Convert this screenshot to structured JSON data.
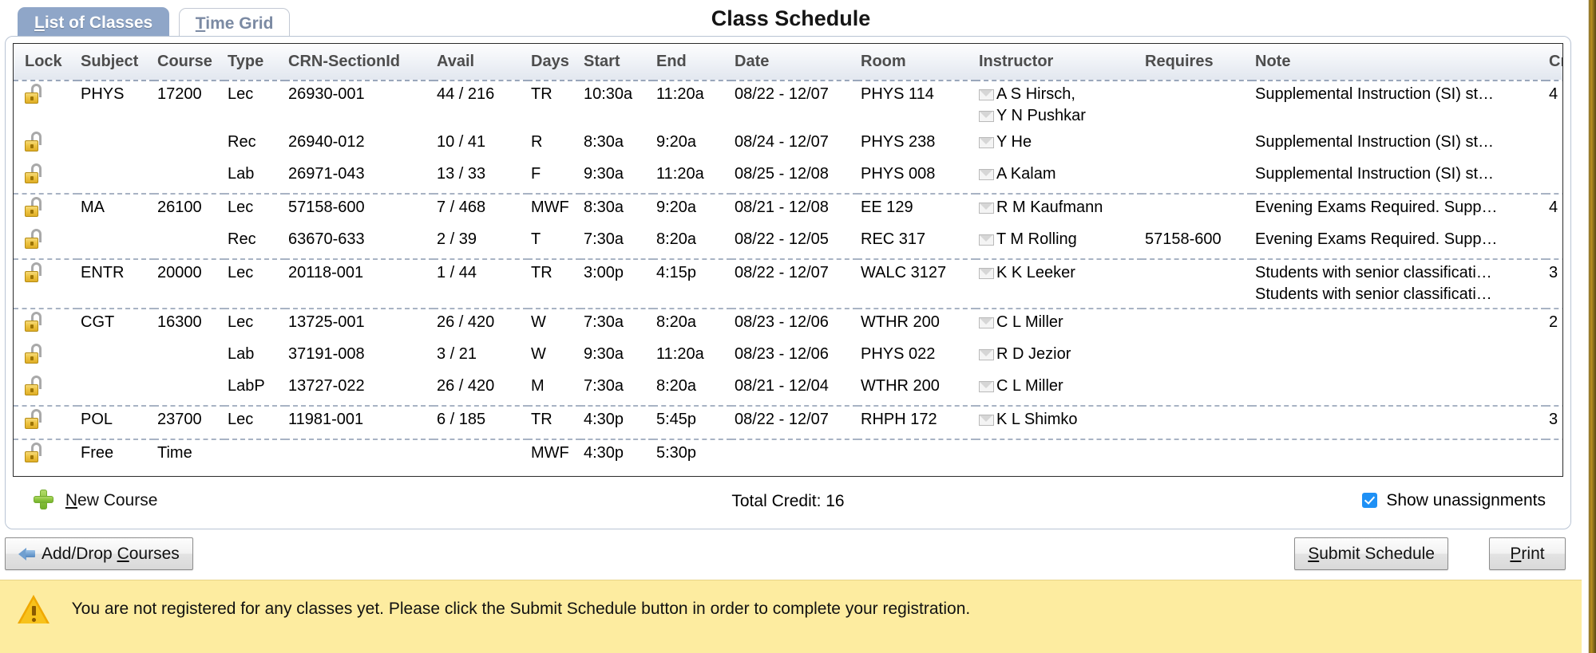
{
  "header": {
    "title": "Class Schedule",
    "tabs": [
      {
        "label": "List of Classes",
        "active": true
      },
      {
        "label": "Time Grid",
        "active": false
      }
    ]
  },
  "table": {
    "columns": [
      "Lock",
      "Subject",
      "Course",
      "Type",
      "CRN-SectionId",
      "Avail",
      "Days",
      "Start",
      "End",
      "Date",
      "Room",
      "Instructor",
      "Requires",
      "Note",
      "Credit"
    ],
    "rows": [
      {
        "group_start": true,
        "subject": "PHYS",
        "course": "17200",
        "type": "Lec",
        "crn": "26930-001",
        "avail": "44 / 216",
        "days": "TR",
        "start": "10:30a",
        "end": "11:20a",
        "date": "08/22 - 12/07",
        "room": "PHYS 114",
        "instructors": [
          "A S Hirsch,",
          "Y N Pushkar"
        ],
        "requires": "",
        "notes": [
          "Supplemental Instruction (SI) st…"
        ],
        "credit": "4"
      },
      {
        "group_start": false,
        "subject": "",
        "course": "",
        "type": "Rec",
        "crn": "26940-012",
        "avail": "10 / 41",
        "days": "R",
        "start": "8:30a",
        "end": "9:20a",
        "date": "08/24 - 12/07",
        "room": "PHYS 238",
        "instructors": [
          "Y He"
        ],
        "requires": "",
        "notes": [
          "Supplemental Instruction (SI) st…"
        ],
        "credit": ""
      },
      {
        "group_start": false,
        "subject": "",
        "course": "",
        "type": "Lab",
        "crn": "26971-043",
        "avail": "13 / 33",
        "days": "F",
        "start": "9:30a",
        "end": "11:20a",
        "date": "08/25 - 12/08",
        "room": "PHYS 008",
        "instructors": [
          "A Kalam"
        ],
        "requires": "",
        "notes": [
          "Supplemental Instruction (SI) st…"
        ],
        "credit": ""
      },
      {
        "group_start": true,
        "subject": "MA",
        "course": "26100",
        "type": "Lec",
        "crn": "57158-600",
        "avail": "7 / 468",
        "days": "MWF",
        "start": "8:30a",
        "end": "9:20a",
        "date": "08/21 - 12/08",
        "room": "EE 129",
        "instructors": [
          "R M Kaufmann"
        ],
        "requires": "",
        "notes": [
          "Evening Exams Required. Supp…"
        ],
        "credit": "4"
      },
      {
        "group_start": false,
        "subject": "",
        "course": "",
        "type": "Rec",
        "crn": "63670-633",
        "avail": "2 / 39",
        "days": "T",
        "start": "7:30a",
        "end": "8:20a",
        "date": "08/22 - 12/05",
        "room": "REC 317",
        "instructors": [
          "T M Rolling"
        ],
        "requires": "57158-600",
        "notes": [
          "Evening Exams Required. Supp…"
        ],
        "credit": ""
      },
      {
        "group_start": true,
        "subject": "ENTR",
        "course": "20000",
        "type": "Lec",
        "crn": "20118-001",
        "avail": "1 / 44",
        "days": "TR",
        "start": "3:00p",
        "end": "4:15p",
        "date": "08/22 - 12/07",
        "room": "WALC 3127",
        "instructors": [
          "K K Leeker"
        ],
        "requires": "",
        "notes": [
          "Students with senior classificati…",
          "Students with senior classificati…"
        ],
        "credit": "3"
      },
      {
        "group_start": true,
        "subject": "CGT",
        "course": "16300",
        "type": "Lec",
        "crn": "13725-001",
        "avail": "26 / 420",
        "days": "W",
        "start": "7:30a",
        "end": "8:20a",
        "date": "08/23 - 12/06",
        "room": "WTHR 200",
        "instructors": [
          "C L Miller"
        ],
        "requires": "",
        "notes": [],
        "credit": "2"
      },
      {
        "group_start": false,
        "subject": "",
        "course": "",
        "type": "Lab",
        "crn": "37191-008",
        "avail": "3 / 21",
        "days": "W",
        "start": "9:30a",
        "end": "11:20a",
        "date": "08/23 - 12/06",
        "room": "PHYS 022",
        "instructors": [
          "R D Jezior"
        ],
        "requires": "",
        "notes": [],
        "credit": ""
      },
      {
        "group_start": false,
        "subject": "",
        "course": "",
        "type": "LabP",
        "crn": "13727-022",
        "avail": "26 / 420",
        "days": "M",
        "start": "7:30a",
        "end": "8:20a",
        "date": "08/21 - 12/04",
        "room": "WTHR 200",
        "instructors": [
          "C L Miller"
        ],
        "requires": "",
        "notes": [],
        "credit": ""
      },
      {
        "group_start": true,
        "subject": "POL",
        "course": "23700",
        "type": "Lec",
        "crn": "11981-001",
        "avail": "6 / 185",
        "days": "TR",
        "start": "4:30p",
        "end": "5:45p",
        "date": "08/22 - 12/07",
        "room": "RHPH 172",
        "instructors": [
          "K L Shimko"
        ],
        "requires": "",
        "notes": [],
        "credit": "3"
      },
      {
        "group_start": true,
        "subject": "Free",
        "course": "Time",
        "type": "",
        "crn": "",
        "avail": "",
        "days": "MWF",
        "start": "4:30p",
        "end": "5:30p",
        "date": "",
        "room": "",
        "instructors": [],
        "requires": "",
        "notes": [],
        "credit": "",
        "no_add": true
      }
    ]
  },
  "panel_footer": {
    "new_course_label": "New Course",
    "new_course_accesskey": "N",
    "total_credit_label": "Total Credit: 16",
    "show_unassignments_label": "Show unassignments",
    "show_unassignments_checked": true
  },
  "buttons": {
    "add_drop": {
      "label": "Add/Drop Courses",
      "accesskey": "C"
    },
    "submit": {
      "label": "Submit Schedule",
      "accesskey": "S"
    },
    "print": {
      "label": "Print",
      "accesskey": "P"
    }
  },
  "warning": {
    "message": "You are not registered for any classes yet. Please click the Submit Schedule button in order to complete your registration."
  },
  "colors": {
    "active_tab": "#8fa6c8",
    "inactive_tab_text": "#7b8aa3",
    "warning_bg": "#fdeca0",
    "checkbox_blue": "#1e90f5",
    "plus_green": "#8ec63f",
    "lock_gold": "#eec443"
  }
}
